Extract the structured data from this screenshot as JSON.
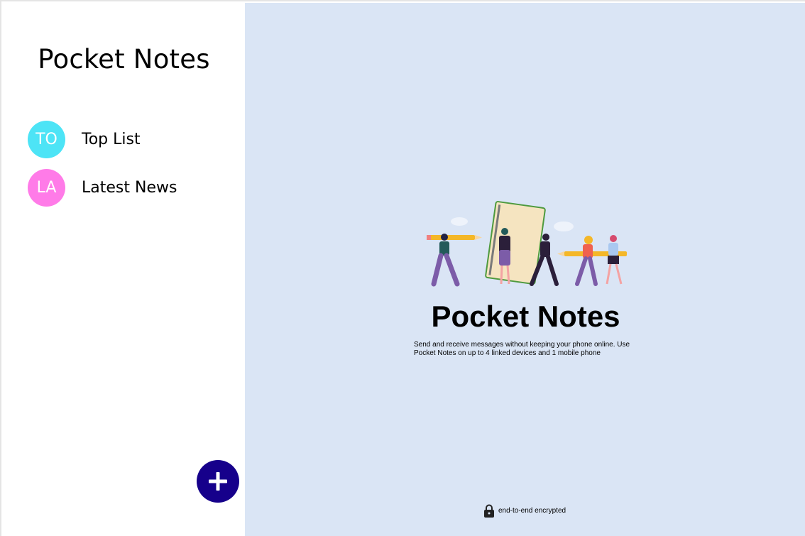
{
  "sidebar": {
    "title": "Pocket Notes",
    "groups": [
      {
        "initials": "TO",
        "name": "Top List",
        "color": "#4de4f6"
      },
      {
        "initials": "LA",
        "name": "Latest News",
        "color": "#ff7be8"
      }
    ],
    "add_button_icon": "plus-icon"
  },
  "main": {
    "title": "Pocket Notes",
    "description": "Send and receive messages without keeping your phone online. Use Pocket Notes on up to 4 linked devices and 1 mobile phone",
    "encryption_note": "end-to-end encrypted",
    "encryption_icon": "lock-icon",
    "illustration": "people-carrying-pencils-and-notebook-illustration"
  },
  "colors": {
    "accent": "#16008b",
    "main_bg": "#dae5f5"
  }
}
